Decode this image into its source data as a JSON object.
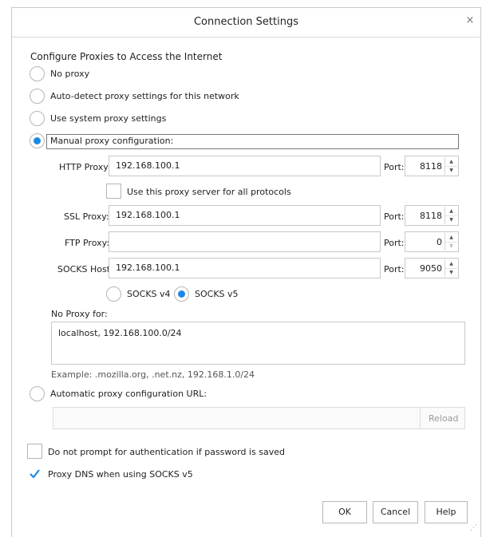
{
  "window": {
    "title": "Connection Settings",
    "close_glyph": "×"
  },
  "section": {
    "heading": "Configure Proxies to Access the Internet"
  },
  "proxy_mode": {
    "no_proxy": "No proxy",
    "auto_detect": "Auto-detect proxy settings for this network",
    "system": "Use system proxy settings",
    "manual": "Manual proxy configuration:",
    "selected": "manual"
  },
  "manual": {
    "http": {
      "label": "HTTP Proxy:",
      "value": "192.168.100.1",
      "port_label": "Port:",
      "port": "8118"
    },
    "use_for_all": {
      "label": "Use this proxy server for all protocols",
      "checked": false
    },
    "ssl": {
      "label": "SSL Proxy:",
      "value": "192.168.100.1",
      "port_label": "Port:",
      "port": "8118"
    },
    "ftp": {
      "label": "FTP Proxy:",
      "value": "",
      "port_label": "Port:",
      "port": "0"
    },
    "socks": {
      "label": "SOCKS Host:",
      "value": "192.168.100.1",
      "port_label": "Port:",
      "port": "9050"
    },
    "socks_v4": "SOCKS v4",
    "socks_v5": "SOCKS v5",
    "socks_version_selected": "v5"
  },
  "no_proxy": {
    "label": "No Proxy for:",
    "value": "localhost, 192.168.100.0/24",
    "example": "Example: .mozilla.org, .net.nz, 192.168.1.0/24"
  },
  "auto_url": {
    "label": "Automatic proxy configuration URL:",
    "value": "",
    "reload": "Reload"
  },
  "options": {
    "no_prompt": {
      "label": "Do not prompt for authentication if password is saved",
      "checked": false
    },
    "proxy_dns": {
      "label": "Proxy DNS when using SOCKS v5",
      "checked": true
    }
  },
  "buttons": {
    "ok": "OK",
    "cancel": "Cancel",
    "help": "Help"
  },
  "colors": {
    "accent": "#1e88e5",
    "border": "#c8c8c8"
  }
}
